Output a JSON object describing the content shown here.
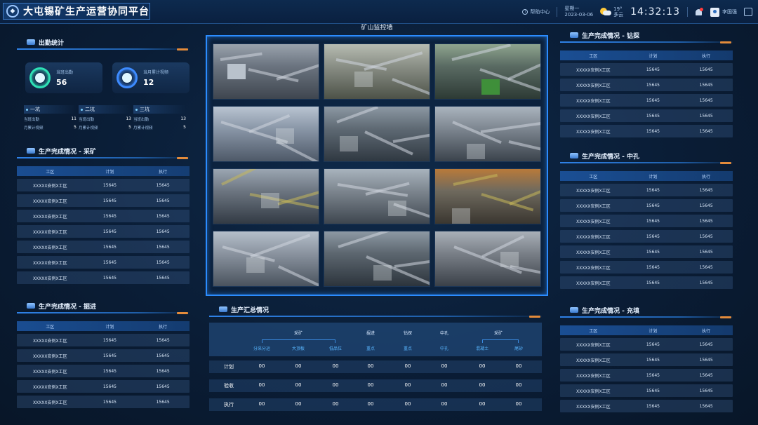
{
  "header": {
    "title": "大屯锡矿生产运营协同平台",
    "help": "帮助中心",
    "weekday": "星期一",
    "date": "2023-03-06",
    "temp": "19°",
    "weather": "多云",
    "time": "14:32:13",
    "user": "李国强"
  },
  "attendance": {
    "title": "出勤统计",
    "cards": [
      {
        "label": "当班出勤",
        "value": "56"
      },
      {
        "label": "当月累计视频",
        "value": "12"
      }
    ],
    "pits": [
      {
        "name": "一坑",
        "r1_label": "当班出勤",
        "r1_val": "11",
        "r2_label": "月累计视频",
        "r2_val": "5"
      },
      {
        "name": "二坑",
        "r1_label": "当班出勤",
        "r1_val": "13",
        "r2_label": "月累计视频",
        "r2_val": "5"
      },
      {
        "name": "三坑",
        "r1_label": "当班出勤",
        "r1_val": "13",
        "r2_label": "月累计视频",
        "r2_val": "5"
      }
    ]
  },
  "left_mining": {
    "title": "生产完成情况 - 采矿",
    "headers": [
      "工区",
      "计划",
      "执行"
    ],
    "rows": [
      [
        "XXXXX安例X工区",
        "15645",
        "15645"
      ],
      [
        "XXXXX安例X工区",
        "15645",
        "15645"
      ],
      [
        "XXXXX安例X工区",
        "15645",
        "15645"
      ],
      [
        "XXXXX安例X工区",
        "15645",
        "15645"
      ],
      [
        "XXXXX安例X工区",
        "15645",
        "15645"
      ],
      [
        "XXXXX安例X工区",
        "15645",
        "15645"
      ],
      [
        "XXXXX安例X工区",
        "15645",
        "15645"
      ]
    ]
  },
  "left_tunnel": {
    "title": "生产完成情况 - 掘进",
    "headers": [
      "工区",
      "计划",
      "执行"
    ],
    "rows": [
      [
        "XXXXX安例X工区",
        "15645",
        "15645"
      ],
      [
        "XXXXX安例X工区",
        "15645",
        "15645"
      ],
      [
        "XXXXX安例X工区",
        "15645",
        "15645"
      ],
      [
        "XXXXX安例X工区",
        "15645",
        "15645"
      ],
      [
        "XXXXX安例X工区",
        "15645",
        "15645"
      ]
    ]
  },
  "video": {
    "title": "矿山监控墙"
  },
  "summary": {
    "title": "生产汇总情况",
    "groups": [
      "采矿",
      "掘进",
      "钻探",
      "中孔",
      "采矿"
    ],
    "subs": [
      "分采分运",
      "大顶板",
      "低品位",
      "重点",
      "重点",
      "中孔",
      "混凝土",
      "尾砂"
    ],
    "rows": [
      {
        "label": "计划",
        "values": [
          "00",
          "00",
          "00",
          "00",
          "00",
          "00",
          "00",
          "00"
        ]
      },
      {
        "label": "验收",
        "values": [
          "00",
          "00",
          "00",
          "00",
          "00",
          "00",
          "00",
          "00"
        ]
      },
      {
        "label": "执行",
        "values": [
          "00",
          "00",
          "00",
          "00",
          "00",
          "00",
          "00",
          "00"
        ]
      }
    ]
  },
  "right_drill": {
    "title": "生产完成情况 - 钻探",
    "headers": [
      "工区",
      "计划",
      "执行"
    ],
    "rows": [
      [
        "XXXXX安例X工区",
        "15645",
        "15645"
      ],
      [
        "XXXXX安例X工区",
        "15645",
        "15645"
      ],
      [
        "XXXXX安例X工区",
        "15645",
        "15645"
      ],
      [
        "XXXXX安例X工区",
        "15645",
        "15645"
      ],
      [
        "XXXXX安例X工区",
        "15645",
        "15645"
      ]
    ]
  },
  "right_hole": {
    "title": "生产完成情况 - 中孔",
    "headers": [
      "工区",
      "计划",
      "执行"
    ],
    "rows": [
      [
        "XXXXX安例X工区",
        "15645",
        "15645"
      ],
      [
        "XXXXX安例X工区",
        "15645",
        "15645"
      ],
      [
        "XXXXX安例X工区",
        "15645",
        "15645"
      ],
      [
        "XXXXX安例X工区",
        "15645",
        "15645"
      ],
      [
        "XXXXX安例X工区",
        "15645",
        "15645"
      ],
      [
        "XXXXX安例X工区",
        "15645",
        "15645"
      ],
      [
        "XXXXX安例X工区",
        "15645",
        "15645"
      ]
    ]
  },
  "right_fill": {
    "title": "生产完成情况 - 充填",
    "headers": [
      "工区",
      "计划",
      "执行"
    ],
    "rows": [
      [
        "XXXXX安例X工区",
        "15645",
        "15645"
      ],
      [
        "XXXXX安例X工区",
        "15645",
        "15645"
      ],
      [
        "XXXXX安例X工区",
        "15645",
        "15645"
      ],
      [
        "XXXXX安例X工区",
        "15645",
        "15645"
      ],
      [
        "XXXXX安例X工区",
        "15645",
        "15645"
      ]
    ]
  }
}
